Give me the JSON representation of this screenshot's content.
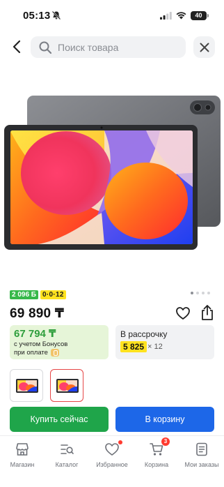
{
  "status_bar": {
    "time": "05:13",
    "battery": "40"
  },
  "search": {
    "placeholder": "Поиск товара"
  },
  "product": {
    "badge_bonus": "2 096 Б",
    "badge_installment": "0·0·12",
    "price": "69 890 ₸",
    "gallery": {
      "total_images": 4,
      "active_index": 0
    }
  },
  "bonus_card": {
    "price": "67 794 ₸",
    "line1": "с учетом Бонусов",
    "line2": "при оплате"
  },
  "installment_card": {
    "title": "В рассрочку",
    "amount": "5 825",
    "months": "× 12"
  },
  "actions": {
    "buy_now": "Купить сейчас",
    "add_to_cart": "В корзину"
  },
  "bottom_nav": {
    "items": [
      {
        "label": "Магазин",
        "icon": "store-icon"
      },
      {
        "label": "Каталог",
        "icon": "catalog-icon"
      },
      {
        "label": "Избранное",
        "icon": "heart-icon",
        "has_dot": true
      },
      {
        "label": "Корзина",
        "icon": "cart-icon",
        "count": "3"
      },
      {
        "label": "Мои заказы",
        "icon": "orders-icon"
      }
    ]
  },
  "colors": {
    "accent_green": "#1fa54a",
    "accent_blue": "#1d67e8",
    "badge_yellow": "#ffe21f",
    "alert_red": "#ff3b30"
  }
}
